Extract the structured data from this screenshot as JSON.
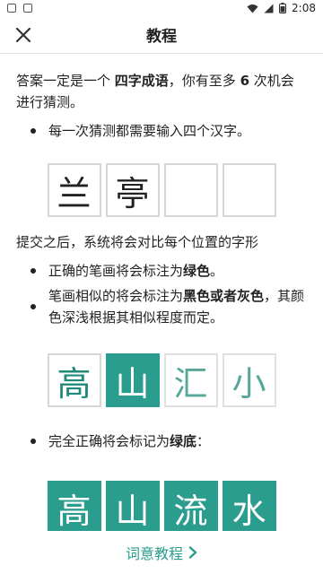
{
  "status_bar": {
    "time": "2:08"
  },
  "header": {
    "title": "教程"
  },
  "intro": {
    "pre": "答案一定是一个 ",
    "bold1": "四字成语",
    "mid": "，你有至多 ",
    "bold2": "6",
    "post": " 次机会进行猜测。"
  },
  "bullet1": "每一次猜测都需要输入四个汉字。",
  "example1": [
    "兰",
    "亭",
    "",
    ""
  ],
  "para2": "提交之后，系统将会对比每个位置的字形",
  "bullet2": {
    "pre": "正确的笔画将会标注为",
    "bold": "绿色",
    "post": "。"
  },
  "bullet3": {
    "pre": "笔画相似的将会标注为",
    "bold": "黑色或者灰色",
    "post": "，其颜色深浅根据其相似程度而定。"
  },
  "example2": [
    "高",
    "山",
    "汇",
    "小"
  ],
  "bullet4": {
    "pre": "完全正确将会标记为",
    "bold": "绿底",
    "post": "："
  },
  "example3": [
    "高",
    "山",
    "流",
    "水"
  ],
  "bottom_link": {
    "label": "词意教程"
  },
  "colors": {
    "accent": "#2a9d8f"
  }
}
